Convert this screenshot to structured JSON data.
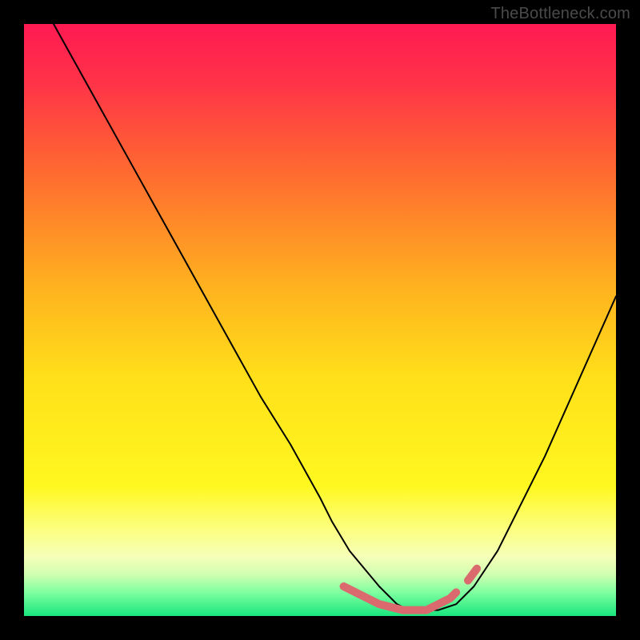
{
  "attribution": "TheBottleneck.com",
  "chart_data": {
    "type": "line",
    "title": "",
    "xlabel": "",
    "ylabel": "",
    "xlim": [
      0,
      100
    ],
    "ylim": [
      0,
      100
    ],
    "grid": false,
    "legend": false,
    "background_gradient": {
      "stops": [
        {
          "pos": 0.0,
          "color": "#ff1a52"
        },
        {
          "pos": 0.1,
          "color": "#ff3348"
        },
        {
          "pos": 0.25,
          "color": "#ff6a30"
        },
        {
          "pos": 0.45,
          "color": "#ffb41e"
        },
        {
          "pos": 0.6,
          "color": "#ffe01a"
        },
        {
          "pos": 0.78,
          "color": "#fff81f"
        },
        {
          "pos": 0.86,
          "color": "#fbff88"
        },
        {
          "pos": 0.9,
          "color": "#f5ffb8"
        },
        {
          "pos": 0.93,
          "color": "#d0ffb0"
        },
        {
          "pos": 0.96,
          "color": "#7effa0"
        },
        {
          "pos": 1.0,
          "color": "#19e67d"
        }
      ]
    },
    "series": [
      {
        "name": "bottleneck-curve",
        "color": "#000000",
        "width": 2,
        "x": [
          5,
          10,
          15,
          20,
          25,
          30,
          35,
          40,
          45,
          50,
          52,
          55,
          60,
          63,
          65,
          68,
          70,
          73,
          76,
          80,
          84,
          88,
          92,
          96,
          100
        ],
        "y": [
          100,
          91,
          82,
          73,
          64,
          55,
          46,
          37,
          29,
          20,
          16,
          11,
          5,
          2,
          1,
          1,
          1,
          2,
          5,
          11,
          19,
          27,
          36,
          45,
          54
        ]
      },
      {
        "name": "bottleneck-highlight",
        "color": "#db6a6e",
        "width": 10,
        "x": [
          54,
          56,
          58,
          60,
          62,
          64,
          66,
          68,
          69,
          70,
          71,
          72,
          73
        ],
        "y": [
          5,
          4,
          3,
          2,
          1.5,
          1,
          1,
          1,
          1.5,
          2,
          2.5,
          3,
          4
        ]
      },
      {
        "name": "bottleneck-highlight-right-dot",
        "color": "#db6a6e",
        "width": 10,
        "x": [
          75,
          76.5
        ],
        "y": [
          6,
          8
        ]
      }
    ]
  }
}
